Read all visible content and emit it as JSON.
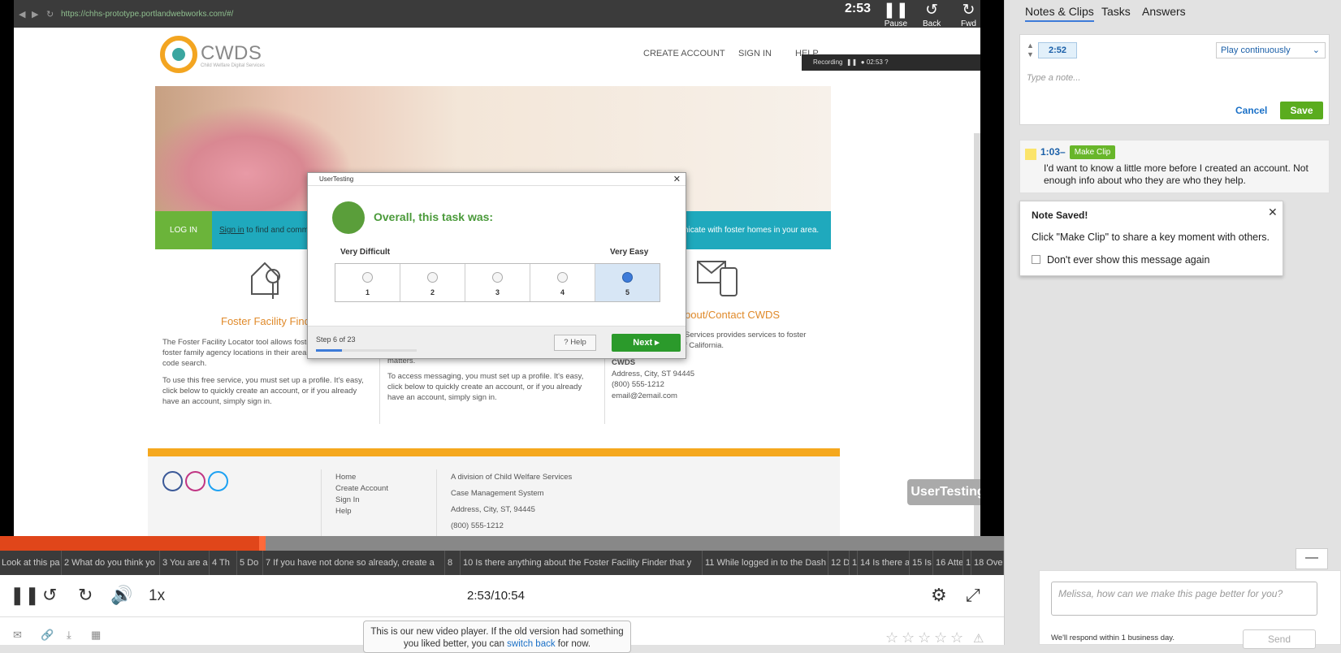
{
  "browser": {
    "url": "https://chhs-prototype.portlandwebworks.com/#/"
  },
  "site": {
    "logo_text": "CWDS",
    "logo_sub": "Child Welfare Digital Services",
    "nav": [
      "CREATE ACCOUNT",
      "SIGN IN",
      "HELP"
    ],
    "login_label": "LOG IN",
    "teal_text_left_link": "Sign in",
    "teal_text_left": " to find and commu",
    "teal_text_right": "nicate with foster homes in your area.",
    "col1_title": "Foster Facility Finder",
    "col1_p1": "The Foster Facility Locator tool allows foster families to locate foster family agency locations in their area with a simple zip-code search.",
    "col1_p2": "To use this free service, you must set up a profile. It's easy, click below to quickly create an account, or if you already have an account, simply sign in.",
    "col2_p_tail": "matters.",
    "col2_p2": "To access messaging, you must set up a profile. It's easy, click below to quickly create an account, or if you already have an account, simply sign in.",
    "col3_title": "bout/Contact CWDS",
    "col3_p1": "Services provides services to foster",
    "col3_p1b": "f California.",
    "col3_name": "CWDS",
    "col3_addr": "Address, City, ST 94445",
    "col3_phone": "(800) 555-1212",
    "col3_email": "email@2email.com",
    "footer_links": [
      "Home",
      "Create Account",
      "Sign In",
      "Help"
    ],
    "footer_info": [
      "A division of Child Welfare Services",
      "Case Management System",
      "Address, City, ST, 94445",
      "(800) 555-1212"
    ]
  },
  "recording": {
    "label": "Recording",
    "time": "02:53"
  },
  "dialog": {
    "window_title": "UserTesting",
    "title": "Overall, this task was:",
    "low_label": "Very Difficult",
    "high_label": "Very Easy",
    "options": [
      "1",
      "2",
      "3",
      "4",
      "5"
    ],
    "selected": 5,
    "step_text": "Step 6 of 23",
    "progress": 0.26,
    "help_label": "Help",
    "next_label": "Next ▸"
  },
  "watermark": "UserTesting",
  "video_controls": {
    "time": "2:53",
    "pause_label": "Pause",
    "back_label": "Back",
    "fwd_label": "Fwd",
    "back_seconds": "5",
    "fwd_seconds": "5"
  },
  "timeline": {
    "progress": 0.258
  },
  "tasks": [
    "Look at this pa",
    "2 What do you think yo",
    "3 You are a",
    "4 Th",
    "5 Do",
    "7 If you have not done so already, create a",
    "8",
    "10 Is there anything about the Foster Facility Finder that y",
    "11 While logged in to the Dash",
    "12 D",
    "1",
    "14 Is there a",
    "15 Is",
    "16 Atte",
    "1",
    "18 Ove"
  ],
  "player": {
    "speed": "1x",
    "current": "2:53",
    "total": "10:54",
    "old_version_text": "This is our new video player. If the old version had something you liked better, you can ",
    "old_version_link": "switch back",
    "old_version_tail": " for now."
  },
  "sidebar": {
    "tabs": [
      "Notes & Clips",
      "Tasks",
      "Answers"
    ],
    "active_tab": 0,
    "note_time": "2:52",
    "play_mode": "Play continuously",
    "note_placeholder": "Type a note...",
    "cancel_label": "Cancel",
    "save_label": "Save",
    "note_item": {
      "time": "1:03–",
      "make_clip": "Make Clip",
      "text": "I'd want to know a little more before I created an account. Not enough info about who they are who they help."
    },
    "tooltip": {
      "title": "Note Saved!",
      "body": "Click \"Make Clip\" to share a key moment with others.",
      "checkbox_label": "Don't ever show this message again"
    }
  },
  "feedback": {
    "placeholder": "Melissa, how can we make this page better for you?",
    "note": "We'll respond within 1 business day.",
    "send_label": "Send",
    "min_label": "—"
  },
  "colors": {
    "accent": "#e0461a",
    "green": "#5aac1e",
    "link": "#1a70c7"
  },
  "icons": [
    "pause-icon",
    "rewind-5-icon",
    "forward-5-icon",
    "volume-icon",
    "settings-icon",
    "fullscreen-icon",
    "email-icon",
    "link-icon",
    "download-icon",
    "excel-icon",
    "star-icon",
    "warning-icon",
    "close-icon"
  ]
}
